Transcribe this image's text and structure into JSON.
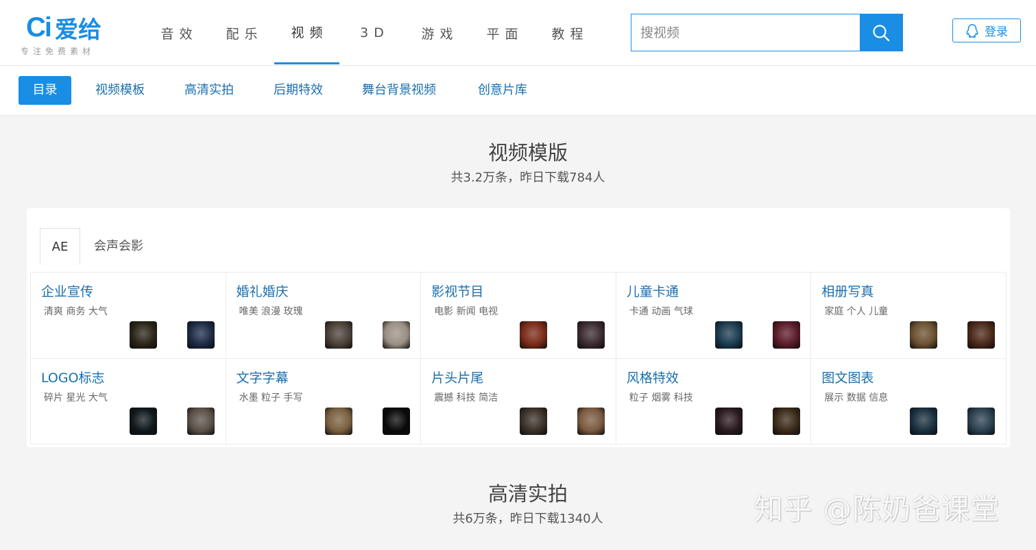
{
  "logo": {
    "ci": "Ci",
    "name": "爱给",
    "slogan": "专注免费素材"
  },
  "nav": {
    "items": [
      {
        "label": "音效"
      },
      {
        "label": "配乐"
      },
      {
        "label": "视频",
        "active": true
      },
      {
        "label": "3D"
      },
      {
        "label": "游戏"
      },
      {
        "label": "平面"
      },
      {
        "label": "教程"
      }
    ]
  },
  "search": {
    "placeholder": "搜视频",
    "value": ""
  },
  "login": {
    "label": "登录"
  },
  "subnav": {
    "items": [
      {
        "label": "目录",
        "active": true
      },
      {
        "label": "视频模板"
      },
      {
        "label": "高清实拍"
      },
      {
        "label": "后期特效"
      },
      {
        "label": "舞台背景视频"
      },
      {
        "label": "创意片库"
      }
    ]
  },
  "section1": {
    "title": "视频模版",
    "subtitle": "共3.2万条，昨日下载784人"
  },
  "tabs": [
    {
      "label": "AE",
      "active": true
    },
    {
      "label": "会声会影"
    }
  ],
  "categories": [
    {
      "title": "企业宣传",
      "tags": "清爽 商务 大气"
    },
    {
      "title": "婚礼婚庆",
      "tags": "唯美 浪漫 玫瑰"
    },
    {
      "title": "影视节目",
      "tags": "电影 新闻 电视"
    },
    {
      "title": "儿童卡通",
      "tags": "卡通 动画 气球"
    },
    {
      "title": "相册写真",
      "tags": "家庭 个人 儿童"
    },
    {
      "title": "LOGO标志",
      "tags": "碎片 星光 大气"
    },
    {
      "title": "文字字幕",
      "tags": "水墨 粒子 手写"
    },
    {
      "title": "片头片尾",
      "tags": "震撼 科技 简洁"
    },
    {
      "title": "风格特效",
      "tags": "粒子 烟雾 科技"
    },
    {
      "title": "图文图表",
      "tags": "展示 数据 信息"
    }
  ],
  "thumb_colors": [
    [
      "#2a2418",
      "#1c2a44"
    ],
    [
      "#4a4038",
      "#9a8f84"
    ],
    [
      "#7a2a18",
      "#3a2a30"
    ],
    [
      "#1a3a50",
      "#5a1a28"
    ],
    [
      "#6a5030",
      "#4a2818"
    ],
    [
      "#10181c",
      "#5a5048"
    ],
    [
      "#7a6040",
      "#0a0a0a"
    ],
    [
      "#3a3028",
      "#7a5a40"
    ],
    [
      "#2a1a20",
      "#3a2a18"
    ],
    [
      "#1a3040",
      "#2a4050"
    ]
  ],
  "section2": {
    "title": "高清实拍",
    "subtitle": "共6万条，昨日下载1340人"
  },
  "watermark": "知乎 @陈奶爸课堂"
}
